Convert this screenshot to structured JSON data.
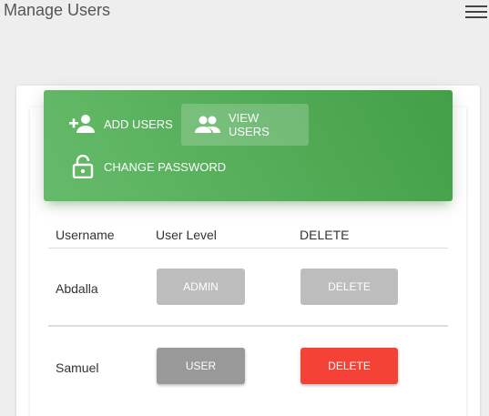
{
  "app": {
    "title": "Manage Users"
  },
  "nav": {
    "add_users": "ADD USERS",
    "view_users": "VIEW USERS",
    "change_password": "CHANGE PASSWORD"
  },
  "table": {
    "headers": {
      "username": "Username",
      "user_level": "User Level",
      "delete": "DELETE"
    },
    "rows": [
      {
        "username": "Abdalla",
        "level": "ADMIN",
        "delete": "DELETE"
      },
      {
        "username": "Samuel",
        "level": "USER",
        "delete": "DELETE"
      }
    ]
  },
  "colors": {
    "nav_green": "#4caf50",
    "delete_red": "#f44336",
    "disabled_grey": "#bdbdbd"
  }
}
